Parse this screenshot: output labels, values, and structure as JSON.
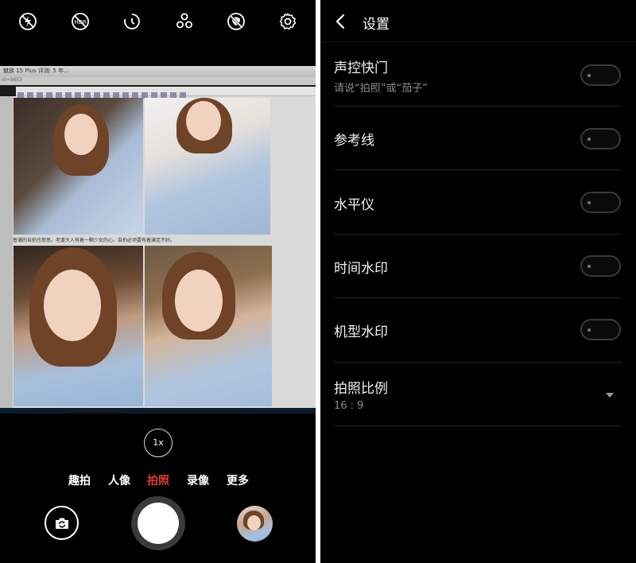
{
  "camera": {
    "viewfinder": {
      "window_title": "魅族 15 Plus 评测: 5 年...",
      "tab_text": "id=9853",
      "caption": "普通的自拍也意思。老婆大人有着一颗少女的心。自拍必须要有着满足不好。"
    },
    "zoom_label": "1x",
    "modes": [
      {
        "label": "趣拍",
        "active": false
      },
      {
        "label": "人像",
        "active": false
      },
      {
        "label": "拍照",
        "active": true
      },
      {
        "label": "录像",
        "active": false
      },
      {
        "label": "更多",
        "active": false
      }
    ],
    "colors": {
      "active_mode": "#e23b3b",
      "background": "#000000"
    }
  },
  "settings": {
    "title": "设置",
    "items": [
      {
        "label": "声控快门",
        "sub": "请说“拍照”或“茄子”",
        "control": "toggle",
        "on": false
      },
      {
        "label": "参考线",
        "control": "toggle",
        "on": false
      },
      {
        "label": "水平仪",
        "control": "toggle",
        "on": false
      },
      {
        "label": "时间水印",
        "control": "toggle",
        "on": false
      },
      {
        "label": "机型水印",
        "control": "toggle",
        "on": false
      },
      {
        "label": "拍照比例",
        "sub": "16 : 9",
        "control": "dropdown"
      }
    ]
  },
  "icons": [
    "flash-off-icon",
    "hdr-off-icon",
    "timer-icon",
    "filter-icon",
    "beauty-off-icon",
    "gear-icon",
    "switch-camera-icon",
    "back-icon",
    "dropdown-arrow-icon"
  ]
}
